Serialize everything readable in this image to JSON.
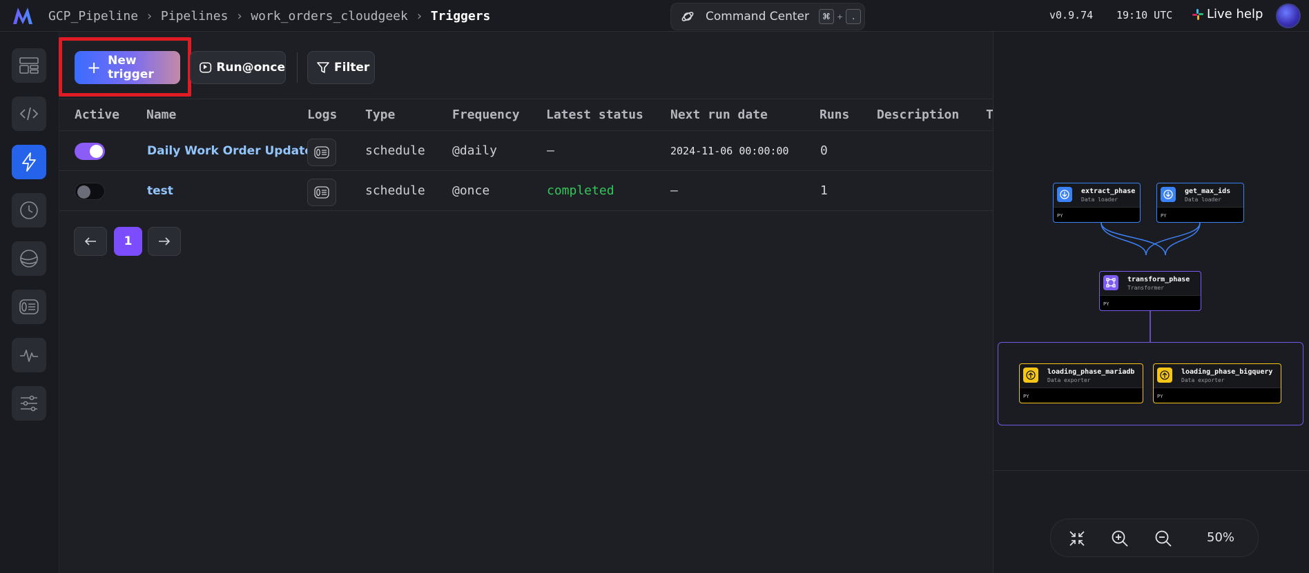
{
  "header": {
    "breadcrumb": [
      "GCP_Pipeline",
      "Pipelines",
      "work_orders_cloudgeek",
      "Triggers"
    ],
    "command_center": {
      "label": "Command Center",
      "key1": "⌘",
      "plus": "+",
      "key2": "."
    },
    "version": "v0.9.74",
    "time": "19:10 UTC",
    "live_help": "Live help"
  },
  "sidebar": {
    "items": [
      {
        "icon": "layout-icon"
      },
      {
        "icon": "code-icon"
      },
      {
        "icon": "lightning-icon",
        "active": true
      },
      {
        "icon": "clock-icon"
      },
      {
        "icon": "planet-icon"
      },
      {
        "icon": "logs-icon"
      },
      {
        "icon": "pulse-icon"
      },
      {
        "icon": "settings-sliders-icon"
      }
    ]
  },
  "toolbar": {
    "new_trigger": "New trigger",
    "run_once": "Run@once",
    "filter": "Filter"
  },
  "table": {
    "columns": [
      "Active",
      "Name",
      "Logs",
      "Type",
      "Frequency",
      "Latest status",
      "Next run date",
      "Runs",
      "Description",
      "T"
    ],
    "rows": [
      {
        "active": true,
        "name": "Daily Work Order Update",
        "type": "schedule",
        "frequency": "@daily",
        "status": "—",
        "next_run": "2024-11-06 00:00:00",
        "runs": "0"
      },
      {
        "active": false,
        "name": "test",
        "type": "schedule",
        "frequency": "@once",
        "status": "completed",
        "next_run": "—",
        "runs": "1"
      }
    ]
  },
  "pagination": {
    "current": "1"
  },
  "graph": {
    "blocks": [
      {
        "title": "extract_phase",
        "subtitle": "Data loader",
        "lang": "PY",
        "color": "#3b82f6"
      },
      {
        "title": "get_max_ids",
        "subtitle": "Data loader",
        "lang": "PY",
        "color": "#3b82f6"
      },
      {
        "title": "transform_phase",
        "subtitle": "Transformer",
        "lang": "PY",
        "color": "#7c5cf0"
      },
      {
        "title": "loading_phase_mariadb",
        "subtitle": "Data exporter",
        "lang": "PY",
        "color": "#f5c518"
      },
      {
        "title": "loading_phase_bigquery",
        "subtitle": "Data exporter",
        "lang": "PY",
        "color": "#f5c518"
      }
    ],
    "zoom": "50%"
  },
  "colors": {
    "accent_primary": "#7c4dff",
    "link": "#93c5fd",
    "success": "#34c759",
    "highlight": "#e01b24"
  }
}
